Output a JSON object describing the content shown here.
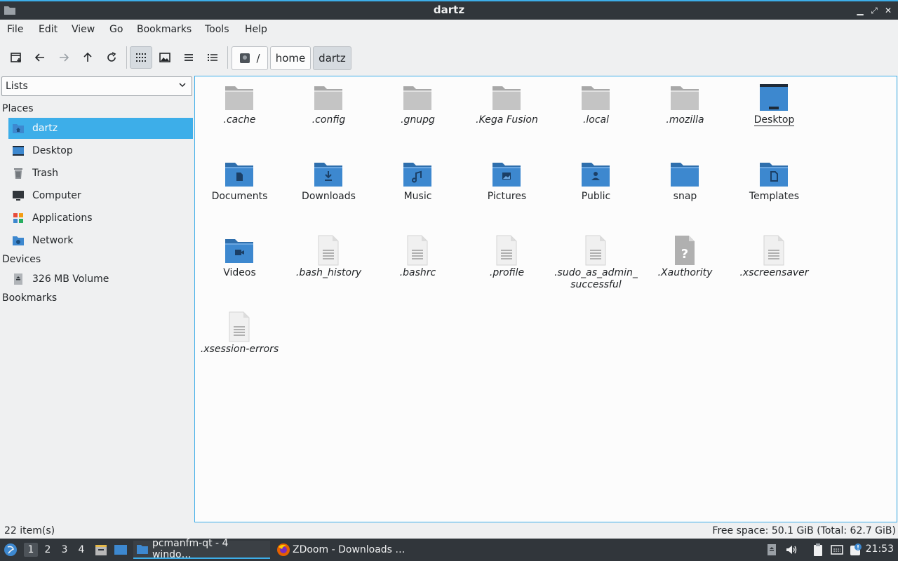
{
  "window": {
    "title": "dartz"
  },
  "menu": [
    "File",
    "Edit",
    "View",
    "Go",
    "Bookmarks",
    "Tools",
    "Help"
  ],
  "path": {
    "root": "/",
    "crumbs": [
      "home",
      "dartz"
    ]
  },
  "sidebar": {
    "selector": "Lists",
    "places_label": "Places",
    "places": [
      {
        "label": "dartz",
        "icon": "home-folder-icon",
        "selected": true
      },
      {
        "label": "Desktop",
        "icon": "desktop-icon"
      },
      {
        "label": "Trash",
        "icon": "trash-icon"
      },
      {
        "label": "Computer",
        "icon": "computer-icon"
      },
      {
        "label": "Applications",
        "icon": "applications-icon"
      },
      {
        "label": "Network",
        "icon": "network-icon"
      }
    ],
    "devices_label": "Devices",
    "devices": [
      {
        "label": "326 MB Volume",
        "icon": "drive-icon"
      }
    ],
    "bookmarks_label": "Bookmarks"
  },
  "files": [
    {
      "name": ".cache",
      "type": "folder-gray",
      "hidden": true
    },
    {
      "name": ".config",
      "type": "folder-gray",
      "hidden": true
    },
    {
      "name": ".gnupg",
      "type": "folder-gray",
      "hidden": true
    },
    {
      "name": ".Kega Fusion",
      "type": "folder-gray",
      "hidden": true
    },
    {
      "name": ".local",
      "type": "folder-gray",
      "hidden": true
    },
    {
      "name": ".mozilla",
      "type": "folder-gray",
      "hidden": true
    },
    {
      "name": "Desktop",
      "type": "desktop",
      "hidden": false,
      "focused": true
    },
    {
      "name": "Documents",
      "type": "folder-documents",
      "hidden": false
    },
    {
      "name": "Downloads",
      "type": "folder-downloads",
      "hidden": false
    },
    {
      "name": "Music",
      "type": "folder-music",
      "hidden": false
    },
    {
      "name": "Pictures",
      "type": "folder-pictures",
      "hidden": false
    },
    {
      "name": "Public",
      "type": "folder-public",
      "hidden": false
    },
    {
      "name": "snap",
      "type": "folder-blue",
      "hidden": false
    },
    {
      "name": "Templates",
      "type": "folder-templates",
      "hidden": false
    },
    {
      "name": "Videos",
      "type": "folder-videos",
      "hidden": false
    },
    {
      "name": ".bash_history",
      "type": "text-file",
      "hidden": true
    },
    {
      "name": ".bashrc",
      "type": "text-file",
      "hidden": true
    },
    {
      "name": ".profile",
      "type": "text-file",
      "hidden": true
    },
    {
      "name": ".sudo_as_admin_ successful",
      "type": "text-file",
      "hidden": true
    },
    {
      "name": ".Xauthority",
      "type": "unknown-file",
      "hidden": true
    },
    {
      "name": ".xscreensaver",
      "type": "text-file",
      "hidden": true
    },
    {
      "name": ".xsession-errors",
      "type": "text-file",
      "hidden": true
    }
  ],
  "status": {
    "count": "22 item(s)",
    "space": "Free space: 50.1 GiB (Total: 62.7 GiB)"
  },
  "taskbar": {
    "desktops": [
      "1",
      "2",
      "3",
      "4"
    ],
    "tasks": [
      {
        "label": "pcmanfm-qt - 4 windo…",
        "icon": "file-manager-icon",
        "active": true
      },
      {
        "label": "ZDoom - Downloads …",
        "icon": "firefox-icon",
        "active": false
      }
    ],
    "clock": "21:53"
  },
  "colors": {
    "accent": "#3daee9",
    "folder_gray": "#b8b8b8",
    "folder_blue": "#3d88cf",
    "titlebar": "#31363b"
  }
}
